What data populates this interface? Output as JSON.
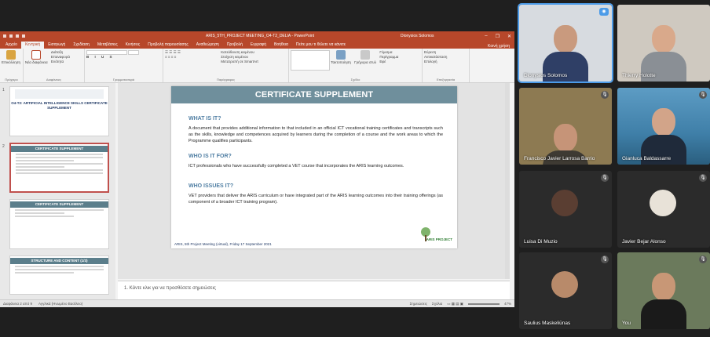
{
  "ppt": {
    "doc_title": "ARIS_5TH_PROJECT MEETING_O4-T2_DELIA  -  PowerPoint",
    "user": "Dionysios Solomos",
    "tabs": [
      "Αρχείο",
      "Κεντρική",
      "Εισαγωγή",
      "Σχεδίαση",
      "Μεταβάσεις",
      "Κινήσεις",
      "Προβολή παρουσίασης",
      "Αναθεώρηση",
      "Προβολή",
      "Εγγραφή",
      "Βοήθεια",
      "Πείτε μου τι θέλετε να κάνετε"
    ],
    "share": "Κοινή χρήση",
    "ribbon": {
      "clipboard": "Πρόχειρο",
      "paste": "Επικόλληση",
      "slides": "Διαφάνειες",
      "new_slide": "Νέα διαφάνεια",
      "layout": "Διάταξη",
      "reset": "Επαναφορά",
      "section": "Ενότητα",
      "font": "Γραμματοσειρά",
      "paragraph": "Παράγραφος",
      "text_direction": "Κατεύθυνση κειμένου",
      "align_text": "Στοίχιση κειμένου",
      "convert_smartart": "Μετατροπή σε SmartArt",
      "drawing": "Σχέδιο",
      "arrange": "Τακτοποίηση",
      "quick_styles": "Γρήγορα στυλ",
      "fill": "Γέμισμα",
      "outline": "Περίγραμμα",
      "effects": "Εφέ",
      "editing": "Επεξεργασία",
      "find": "Εύρεση",
      "replace": "Αντικατάσταση",
      "select": "Επιλογή"
    },
    "thumbs": [
      {
        "num": "1",
        "title": "O4-T2: ARTIFICIAL INTELLIGENCE SKILLS CERTIFICATE SUPPLEMENT"
      },
      {
        "num": "2",
        "title": "CERTIFICATE SUPPLEMENT"
      },
      {
        "num": "3",
        "title": "CERTIFICATE SUPPLEMENT"
      },
      {
        "num": "4",
        "title": "STRUCTURE AND CONTENT (1/3)"
      }
    ],
    "slide": {
      "title": "CERTIFICATE SUPPLEMENT",
      "h1": "WHAT IS IT?",
      "p1": "A document that provides additional information to that included in an official ICT vocational training certificates and transcripts such as the skills, knowledge and competences acquired by learners during the completion of a course and the work areas to which the Programme qualifies participants.",
      "h2": "WHO IS IT FOR?",
      "p2": "ICT professionals who have successfully completed a VET course that incorporates the ARIS learning outcomes.",
      "h3": "WHO ISSUES IT?",
      "p3": "VET providers that deliver the ARIS curriculum or have integrated part of the ARIS learning outcomes into their training offerings (as component of a broader ICT training program).",
      "footer": "ARIS, 5th Project Meeting (virtual), Friday 17 September 2021",
      "logo_text": "ARIS PROJECT"
    },
    "notes": "1.    Κάντε κλικ για να προσθέσετε σημειώσεις",
    "status": {
      "slide": "Διαφάνεια 2 από 9",
      "language": "Αγγλικά (Ηνωμένο Βασίλειο)",
      "notes": "Σημειώσεις",
      "comments": "Σχόλια",
      "zoom": "47%"
    }
  },
  "participants": [
    {
      "name": "Dionysios Solomos",
      "colors": {
        "bg": "#d7dbe0",
        "face": "#c99a7e",
        "shirt": "#2f3f66"
      }
    },
    {
      "name": "Thierry Holotte",
      "colors": {
        "bg": "#cfc9c0",
        "face": "#d9a98b",
        "shirt": "#8a8f95"
      }
    },
    {
      "name": "Francisco Javier Larrosa Barrio",
      "colors": {
        "bg": "#8d7a52",
        "face": "#c69478",
        "shirt": "#3e3a33"
      }
    },
    {
      "name": "Gianluca Baldassarre",
      "colors": {
        "bg": "#3f7fa8",
        "face": "#d2a489",
        "shirt": "#1f2a3a"
      }
    },
    {
      "name": "Luisa Di Muzio"
    },
    {
      "name": "Javier Bejar Alonso"
    },
    {
      "name": "Saulius Maskeliūnas"
    },
    {
      "name": "You",
      "colors": {
        "bg": "#6b7a5c",
        "face": "#c89776",
        "shirt": "#1a1a1a"
      }
    }
  ]
}
